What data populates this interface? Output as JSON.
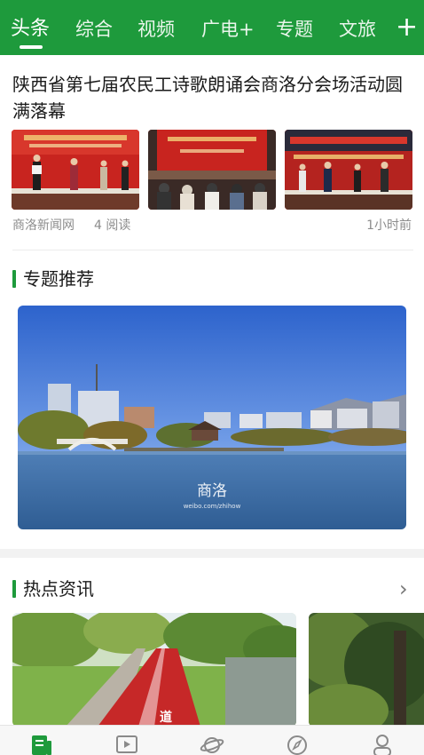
{
  "tabs": [
    {
      "label": "头条",
      "active": true
    },
    {
      "label": "综合"
    },
    {
      "label": "视频"
    },
    {
      "label": "广电+"
    },
    {
      "label": "专题"
    },
    {
      "label": "文旅"
    }
  ],
  "add_tab_icon": "plus-icon",
  "article": {
    "title": "陕西省第七届农民工诗歌朗诵会商洛分会场活动圆满落幕",
    "source": "商洛新闻网",
    "reads": "4 阅读",
    "time": "1小时前"
  },
  "topics": {
    "title": "专题推荐",
    "image_caption": "商洛",
    "image_credit": "weibo.com/zhihow"
  },
  "hot": {
    "title": "热点资讯",
    "more_icon": "chevron-right-icon"
  },
  "bottom_nav": {
    "items": [
      "news-icon",
      "video-icon",
      "planet-icon",
      "compass-icon",
      "user-icon"
    ],
    "active_color": "#1e9a3c",
    "inactive_color": "#8a8a8a"
  },
  "colors": {
    "brand": "#1e9a3c",
    "banner_red": "#c8241f"
  }
}
